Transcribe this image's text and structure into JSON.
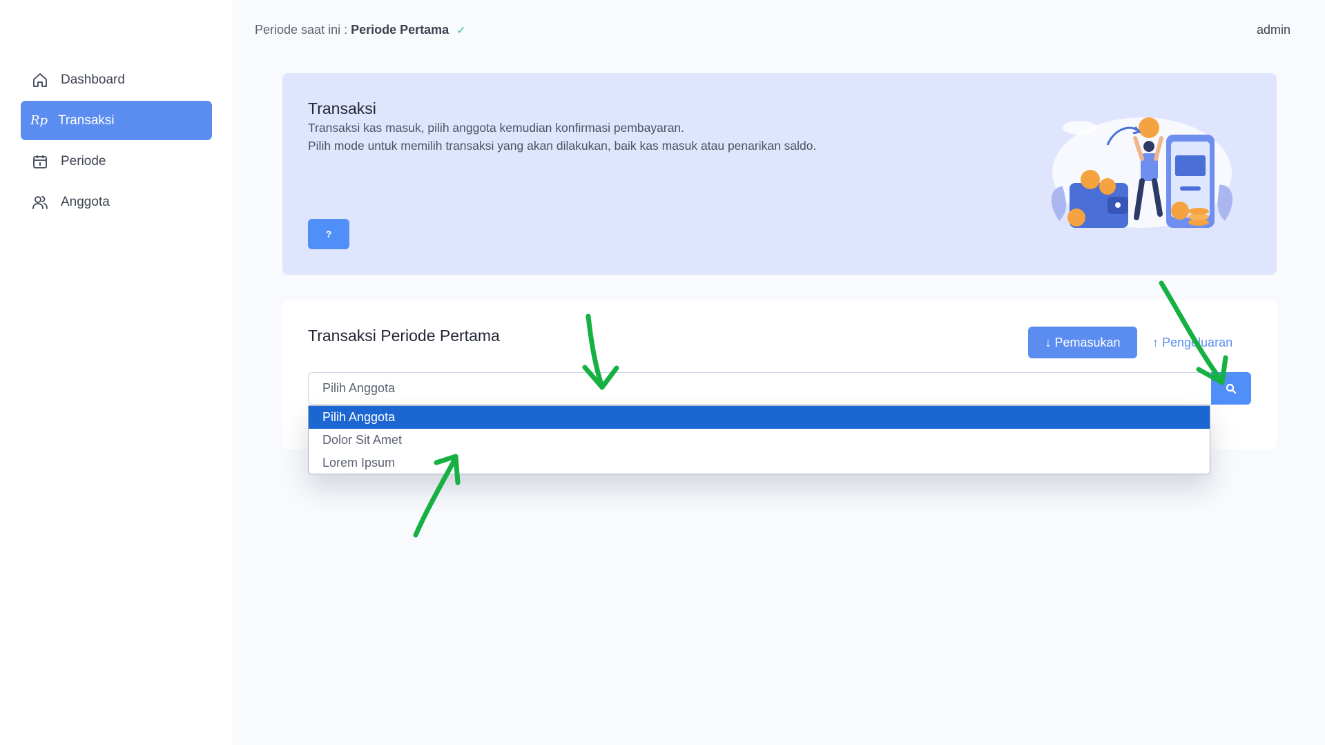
{
  "topbar": {
    "period_prefix": "Periode saat ini :",
    "period_name": "Periode Pertama",
    "check_icon": "✓",
    "user": "admin"
  },
  "sidebar": {
    "items": [
      {
        "label": "Dashboard",
        "icon": "home-icon"
      },
      {
        "label": "Transaksi",
        "icon": "rupiah-icon",
        "icon_text": "Rp",
        "active": true
      },
      {
        "label": "Periode",
        "icon": "calendar-icon"
      },
      {
        "label": "Anggota",
        "icon": "users-icon"
      }
    ]
  },
  "hero": {
    "title": "Transaksi",
    "line1": "Transaksi kas masuk, pilih anggota kemudian konfirmasi pembayaran.",
    "line2": "Pilih mode untuk memilih transaksi yang akan dilakukan, baik kas masuk atau penarikan saldo.",
    "help_label": "?"
  },
  "card": {
    "title": "Transaksi Periode Pertama",
    "income_label": "↓ Pemasukan",
    "expense_label": "↑ Pengeluaran",
    "select_value": "Pilih Anggota",
    "options": [
      "Pilih Anggota",
      "Dolor Sit Amet",
      "Lorem Ipsum"
    ],
    "selected_index": 0
  },
  "colors": {
    "accent": "#5b8df0",
    "hero_bg": "#dfe5fc",
    "option_selected": "#1c66d2",
    "annotation": "#16b043"
  }
}
